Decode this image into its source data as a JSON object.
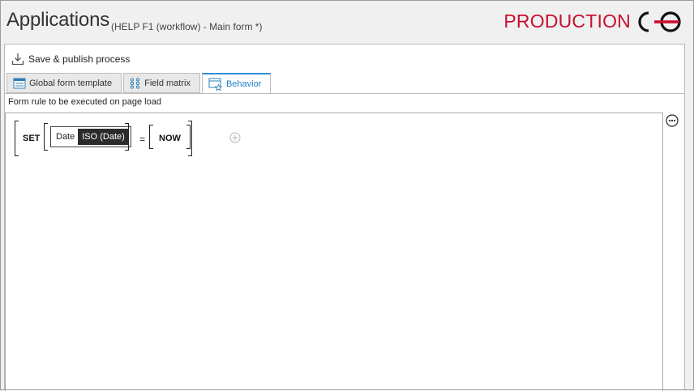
{
  "header": {
    "title": "Applications",
    "subtitle": "(HELP F1 (workflow) - Main form *)",
    "environment": "PRODUCTION",
    "environment_color": "#c8102e"
  },
  "toolbar": {
    "save_publish_label": "Save & publish process",
    "save_publish_icon": "download-tray-icon"
  },
  "tabs": [
    {
      "label": "Global form template",
      "icon": "form-template-icon",
      "active": false
    },
    {
      "label": "Field matrix",
      "icon": "field-matrix-icon",
      "active": false
    },
    {
      "label": "Behavior",
      "icon": "behavior-window-star-icon",
      "active": true
    }
  ],
  "accent_color": "#2d8fd6",
  "behavior": {
    "section_label": "Form rule to be executed on page load",
    "rule": {
      "keyword": "SET",
      "field_name": "Date",
      "field_type": "ISO (Date)",
      "operator": "=",
      "value": "NOW"
    },
    "add_icon": "plus-circle-icon",
    "more_icon": "ellipsis-icon"
  }
}
